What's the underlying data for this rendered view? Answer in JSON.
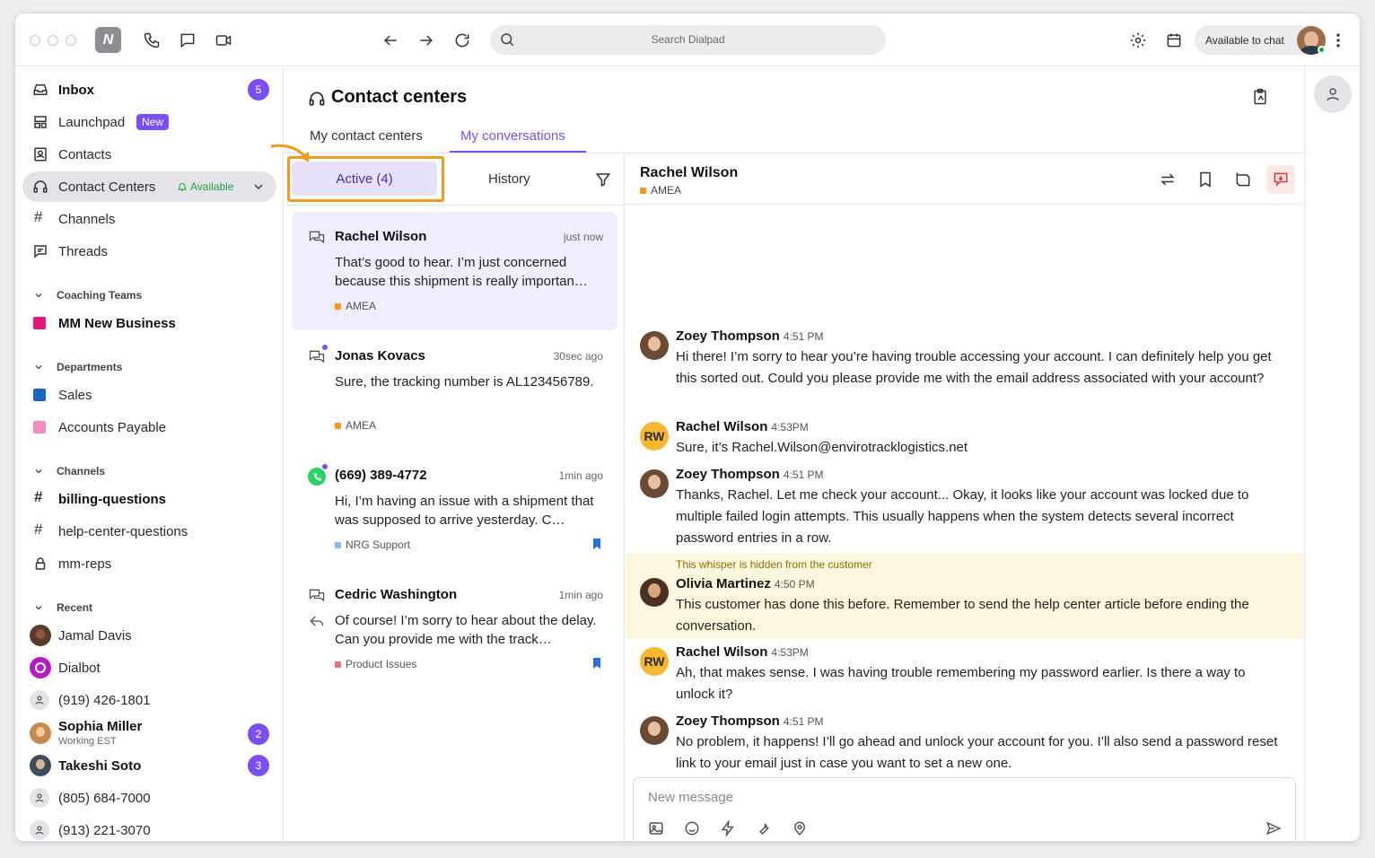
{
  "colors": {
    "accent": "#7b4ef0",
    "highlight": "#f39a1c",
    "online": "#22a046",
    "whisper_bg": "#fdf8dd"
  },
  "titlebar": {
    "logo_text": "N",
    "search_placeholder": "Search Dialpad",
    "status": "Available to chat"
  },
  "sidebar": {
    "inbox": {
      "label": "Inbox",
      "badge": "5"
    },
    "launchpad": {
      "label": "Launchpad",
      "tag": "New"
    },
    "contacts": {
      "label": "Contacts"
    },
    "contact_centers": {
      "label": "Contact Centers",
      "status": "Available"
    },
    "channels_nav": {
      "label": "Channels"
    },
    "threads": {
      "label": "Threads"
    },
    "coaching_header": "Coaching Teams",
    "coaching_items": [
      {
        "label": "MM New Business",
        "color": "#e8157a"
      }
    ],
    "departments_header": "Departments",
    "departments": [
      {
        "label": "Sales",
        "color": "#1e63c7"
      },
      {
        "label": "Accounts Payable",
        "color": "#f08fc7"
      }
    ],
    "channels_header": "Channels",
    "channels": [
      "billing-questions",
      "help-center-questions",
      "mm-reps"
    ],
    "recent_header": "Recent",
    "recent": [
      {
        "label": "Jamal Davis"
      },
      {
        "label": "Dialbot"
      },
      {
        "label": "(919) 426-1801"
      },
      {
        "label": "Sophia Miller",
        "sub": "Working EST",
        "badge": "2"
      },
      {
        "label": "Takeshi Soto",
        "badge": "3"
      },
      {
        "label": "(805) 684-7000"
      },
      {
        "label": "(913) 221-3070"
      }
    ]
  },
  "main": {
    "title": "Contact centers",
    "tabs": [
      "My contact centers",
      "My conversations"
    ]
  },
  "list": {
    "active_label": "Active (4)",
    "history_label": "History",
    "conversations": [
      {
        "name": "Rachel Wilson",
        "time": "just now",
        "msg": "That’s good to hear. I’m just concerned because this shipment is really importan…",
        "tag": "AMEA",
        "tag_color": "#f39a1c"
      },
      {
        "name": "Jonas Kovacs",
        "time": "30sec ago",
        "msg": "Sure, the tracking number is AL123456789.",
        "tag": "AMEA",
        "tag_color": "#f39a1c"
      },
      {
        "name": "(669) 389-4772",
        "time": "1min ago",
        "msg": "Hi, I’m having an issue with a shipment that was supposed to arrive yesterday. C…",
        "tag": "NRG Support",
        "tag_color": "#8fb7f0"
      },
      {
        "name": "Cedric Washington",
        "time": "1min ago",
        "msg": "Of course! I’m sorry to hear about the delay. Can you provide me with the track…",
        "tag": "Product Issues",
        "tag_color": "#f0707a"
      }
    ]
  },
  "chat": {
    "name": "Rachel Wilson",
    "region": "AMEA",
    "messages": [
      {
        "who": "Zoey Thompson",
        "when": "4:51 PM",
        "text": "Hi there! I’m sorry to hear you’re having trouble accessing your account. I can definitely help you get this sorted out. Could you please provide me with the email address associated with your account?"
      },
      {
        "who": "Rachel Wilson",
        "when": "4:53PM",
        "initials": "RW",
        "text": "Sure, it’s Rachel.Wilson@envirotracklogistics.net"
      },
      {
        "who": "Zoey Thompson",
        "when": "4:51 PM",
        "text": "Thanks, Rachel. Let me check your account... Okay, it looks like your account was locked due to multiple failed login attempts. This usually happens when the system detects several incorrect password entries in a row."
      },
      {
        "who": "Olivia Martinez",
        "when": "4:50 PM",
        "note": "This whisper is hidden from the customer",
        "text": "This customer has done this before. Remember to send the help center article before ending the conversation."
      },
      {
        "who": "Rachel Wilson",
        "when": "4:53PM",
        "initials": "RW",
        "text": "Ah, that makes sense. I was having trouble remembering my password earlier. Is there a way to unlock it?"
      },
      {
        "who": "Zoey Thompson",
        "when": "4:51 PM",
        "text": "No problem, it happens! I’ll go ahead and unlock your account for you. I’ll also send a password reset link to your email just in case you want to set a new one."
      }
    ],
    "composer_placeholder": "New message"
  }
}
